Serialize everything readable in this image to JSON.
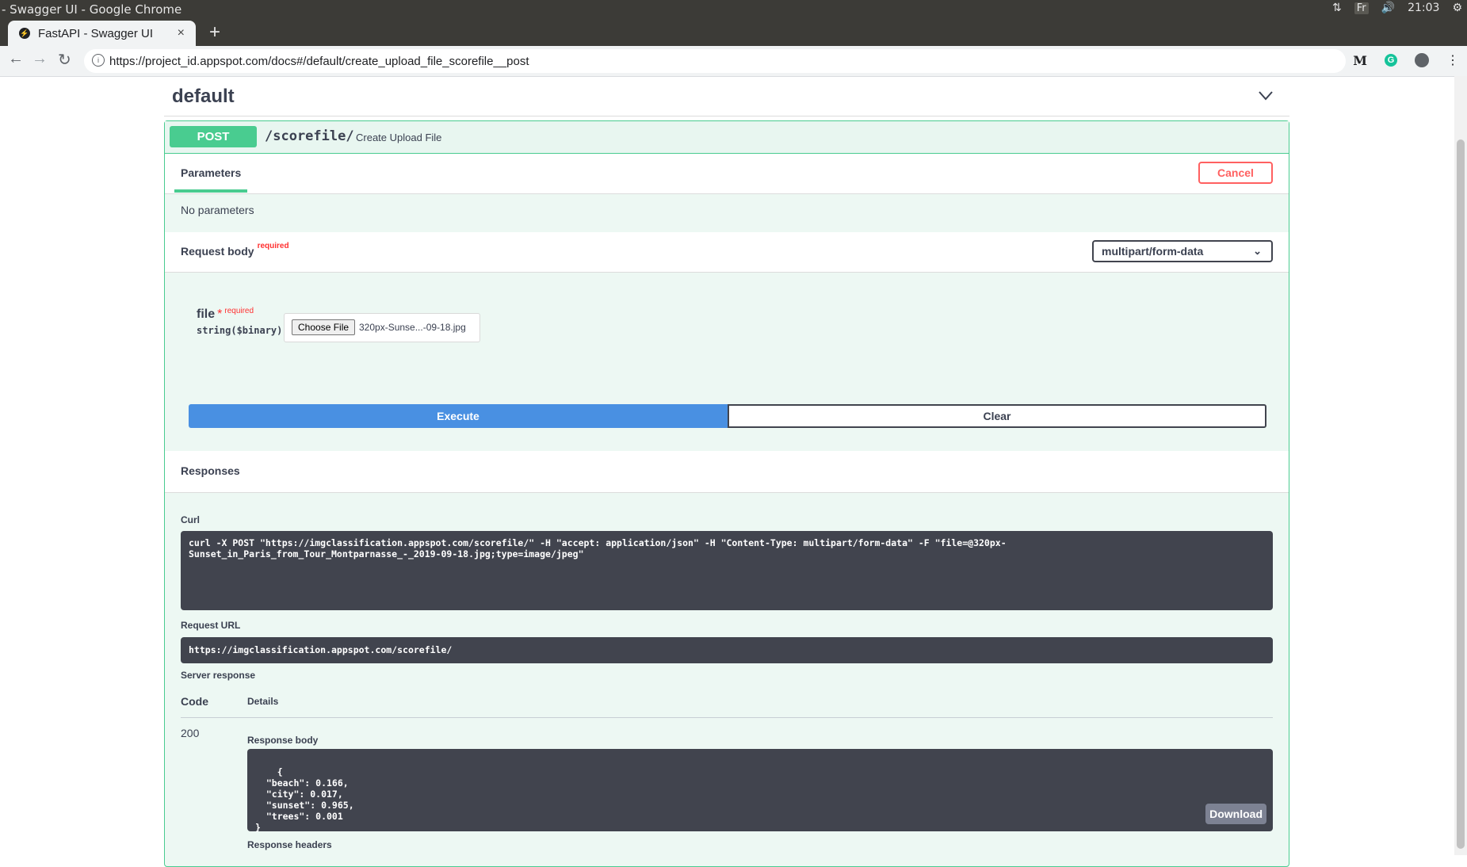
{
  "os": {
    "window_title": "- Swagger UI - Google Chrome",
    "lang": "Fr",
    "time": "21:03"
  },
  "browser": {
    "tab_title": "FastAPI - Swagger UI",
    "tab_close": "×",
    "new_tab": "+",
    "url": "https://project_id.appspot.com/docs#/default/create_upload_file_scorefile__post",
    "ext_m": "M",
    "ext_g": "G"
  },
  "section": {
    "title": "default"
  },
  "operation": {
    "method": "POST",
    "path": "/scorefile/",
    "description": "Create Upload File",
    "parameters_tab": "Parameters",
    "cancel_label": "Cancel",
    "no_parameters": "No parameters",
    "request_body_label": "Request body",
    "required_label": "required",
    "content_type": "multipart/form-data",
    "file_param": {
      "name": "file",
      "star": "*",
      "required": "required",
      "type": "string($binary)",
      "choose_label": "Choose File",
      "chosen_file": "320px-Sunse...-09-18.jpg"
    },
    "execute_label": "Execute",
    "clear_label": "Clear"
  },
  "responses": {
    "title": "Responses",
    "curl_label": "Curl",
    "curl_command": "curl -X POST \"https://imgclassification.appspot.com/scorefile/\" -H \"accept: application/json\" -H \"Content-Type: multipart/form-data\" -F \"file=@320px-\nSunset_in_Paris_from_Tour_Montparnasse_-_2019-09-18.jpg;type=image/jpeg\"",
    "request_url_label": "Request URL",
    "request_url": "https://imgclassification.appspot.com/scorefile/",
    "server_response_label": "Server response",
    "code_header": "Code",
    "details_header": "Details",
    "status_code": "200",
    "response_body_label": "Response body",
    "response_body": "{\n  \"beach\": 0.166,\n  \"city\": 0.017,\n  \"sunset\": 0.965,\n  \"trees\": 0.001\n}",
    "download_label": "Download",
    "response_headers_label": "Response headers"
  },
  "colors": {
    "post_green": "#49cc90",
    "execute_blue": "#4990e2",
    "cancel_red": "#ff6060",
    "code_bg": "#41444e"
  }
}
